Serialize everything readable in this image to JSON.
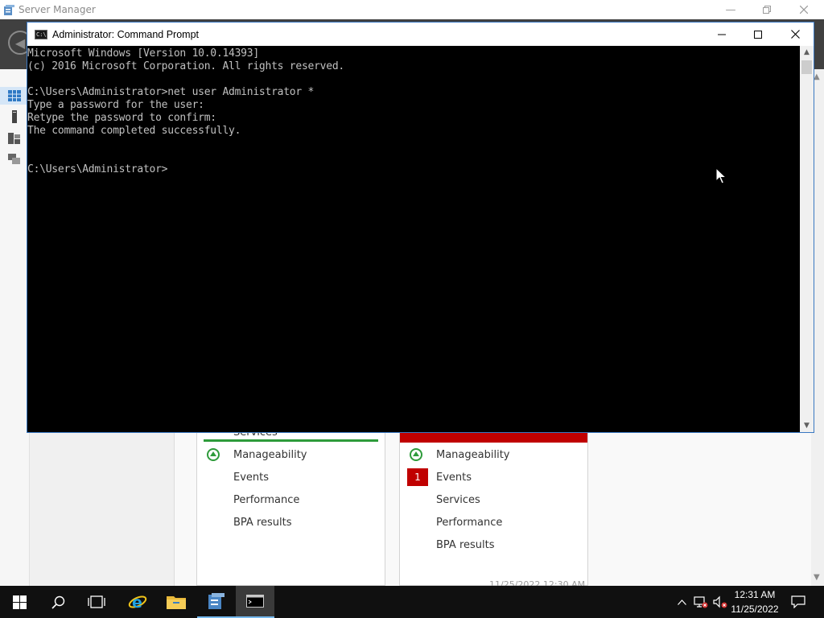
{
  "server_manager": {
    "title": "Server Manager",
    "tiles": [
      {
        "partial_heading": "Services",
        "accent_color": "#2e9b3b",
        "rows": [
          {
            "label": "Manageability",
            "status": "ok"
          },
          {
            "label": "Events",
            "status": "none"
          },
          {
            "label": "Performance",
            "status": "none"
          },
          {
            "label": "BPA results",
            "status": "none"
          }
        ]
      },
      {
        "accent_color": "#c00000",
        "rows": [
          {
            "label": "Manageability",
            "status": "ok"
          },
          {
            "label": "Events",
            "status": "badge",
            "badge": "1"
          },
          {
            "label": "Services",
            "status": "none"
          },
          {
            "label": "Performance",
            "status": "none"
          },
          {
            "label": "BPA results",
            "status": "none"
          }
        ],
        "timestamp": "11/25/2022 12:30 AM"
      }
    ]
  },
  "cmd_window": {
    "title": "Administrator: Command Prompt",
    "lines": [
      "Microsoft Windows [Version 10.0.14393]",
      "(c) 2016 Microsoft Corporation. All rights reserved.",
      "",
      "C:\\Users\\Administrator>net user Administrator *",
      "Type a password for the user:",
      "Retype the password to confirm:",
      "The command completed successfully.",
      "",
      "",
      "C:\\Users\\Administrator>"
    ]
  },
  "taskbar": {
    "buttons": [
      {
        "name": "start",
        "icon": "windows-logo-icon"
      },
      {
        "name": "search",
        "icon": "search-icon"
      },
      {
        "name": "task-view",
        "icon": "task-view-icon"
      },
      {
        "name": "internet-explorer",
        "icon": "internet-explorer-icon"
      },
      {
        "name": "file-explorer",
        "icon": "folder-icon"
      },
      {
        "name": "server-manager",
        "icon": "server-manager-icon"
      },
      {
        "name": "command-prompt",
        "icon": "cmd-icon"
      }
    ],
    "clock": {
      "time": "12:31 AM",
      "date": "11/25/2022"
    }
  }
}
